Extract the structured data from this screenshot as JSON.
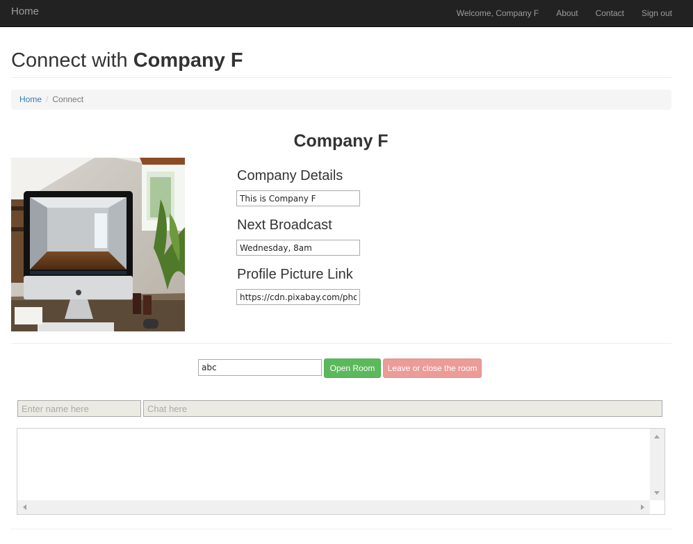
{
  "navbar": {
    "brand": "Home",
    "welcome": "Welcome, Company F",
    "links": [
      "About",
      "Contact",
      "Sign out"
    ]
  },
  "page": {
    "title_prefix": "Connect with ",
    "title_bold": "Company F"
  },
  "breadcrumb": {
    "home": "Home",
    "separator": "/",
    "current": "Connect"
  },
  "company": {
    "name": "Company F",
    "photo_icon": "desktop-computer-photo",
    "details_label": "Company Details",
    "details_value": "This is Company F",
    "broadcast_label": "Next Broadcast",
    "broadcast_value": "Wednesday, 8am",
    "picture_label": "Profile Picture Link",
    "picture_value": "https://cdn.pixabay.com/phot"
  },
  "room": {
    "room_value": "abc",
    "open_label": "Open Room",
    "leave_label": "Leave or close the room"
  },
  "chat": {
    "name_placeholder": "Enter name here",
    "chat_placeholder": "Chat here"
  },
  "colors": {
    "navbar": "#222222",
    "open_button": "#5cb85c",
    "leave_button": "#eb9b98",
    "link": "#337ab7"
  }
}
